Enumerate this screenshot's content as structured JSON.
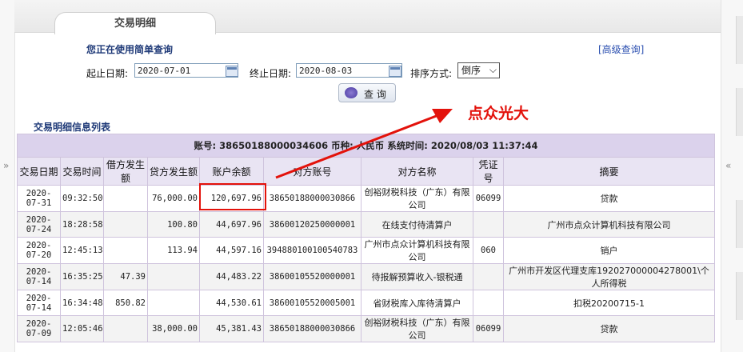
{
  "tab": {
    "title": "交易明细"
  },
  "form": {
    "hint": "您正在使用简单查询",
    "advanced_link": "[高级查询]",
    "start_label": "起止日期:",
    "start_value": "2020-07-01",
    "end_label": "终止日期:",
    "end_value": "2020-08-03",
    "sort_label": "排序方式:",
    "sort_value": "倒序",
    "query_button": "查 询"
  },
  "annotation": {
    "text": "点众光大",
    "color": "#e3120b"
  },
  "list": {
    "title": "交易明细信息列表",
    "account_line": "账号: 38650188000034606    币种: 人民币    系统时间: 2020/08/03 11:37:44"
  },
  "table": {
    "headers": [
      "交易日期",
      "交易时间",
      "借方发生额",
      "贷方发生额",
      "账户余额",
      "对方账号",
      "对方名称",
      "凭证号",
      "摘要"
    ],
    "rows": [
      {
        "date": "2020-07-31",
        "time": "09:32:50",
        "debit": "",
        "credit": "76,000.00",
        "balance": "120,697.96",
        "cp_account": "38650188000030866",
        "cp_name": "创裕财税科技（广东）有限公司",
        "voucher": "06099",
        "memo": "贷款"
      },
      {
        "date": "2020-07-24",
        "time": "18:28:58",
        "debit": "",
        "credit": "100.80",
        "balance": "44,697.96",
        "cp_account": "38600120250000001",
        "cp_name": "在线支付待清算户",
        "voucher": "",
        "memo": "广州市点众计算机科技有限公司"
      },
      {
        "date": "2020-07-20",
        "time": "12:45:13",
        "debit": "",
        "credit": "113.94",
        "balance": "44,597.16",
        "cp_account": "39488010010054078З",
        "cp_name": "广州市点众计算机科技有限公司",
        "voucher": "060",
        "memo": "销户"
      },
      {
        "date": "2020-07-14",
        "time": "16:35:25",
        "debit": "47.39",
        "credit": "",
        "balance": "44,483.22",
        "cp_account": "38600105520000001",
        "cp_name": "待报解预算收入-银税通",
        "voucher": "",
        "memo": "广州市开发区代理支库192027000004278001\\个人所得税"
      },
      {
        "date": "2020-07-14",
        "time": "16:34:48",
        "debit": "850.82",
        "credit": "",
        "balance": "44,530.61",
        "cp_account": "38600105520005001",
        "cp_name": "省财税库入库待清算户",
        "voucher": "",
        "memo": "扣税20200715-1"
      },
      {
        "date": "2020-07-09",
        "time": "12:05:46",
        "debit": "",
        "credit": "38,000.00",
        "balance": "45,381.43",
        "cp_account": "38650188000030866",
        "cp_name": "创裕财税科技（广东）有限公司",
        "voucher": "06099",
        "memo": "贷款"
      }
    ]
  }
}
